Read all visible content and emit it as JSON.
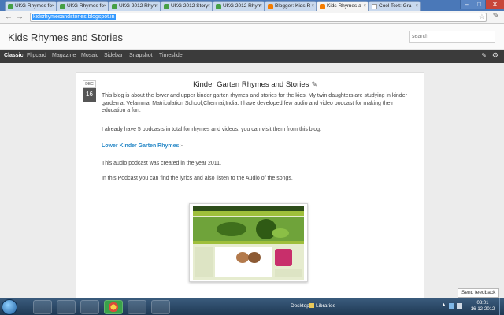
{
  "tabs": [
    {
      "label": "UKG Rhymes fo",
      "favicon": "green-doc-icon"
    },
    {
      "label": "UKG Rhymes fo",
      "favicon": "green-doc-icon"
    },
    {
      "label": "UKG 2012 Rhyn",
      "favicon": "green-doc-icon"
    },
    {
      "label": "UKG 2012 Story",
      "favicon": "green-doc-icon"
    },
    {
      "label": "UKG 2012 Rhym",
      "favicon": "green-doc-icon"
    },
    {
      "label": "Blogger: Kids R",
      "favicon": "blogger-icon"
    },
    {
      "label": "Kids Rhymes a",
      "favicon": "blogger-icon",
      "active": true
    },
    {
      "label": "Cool Text: Gra",
      "favicon": "doc-icon"
    }
  ],
  "address_bar": {
    "url": "kidsrhymesandstories.blogspot.in"
  },
  "blog": {
    "title": "Kids Rhymes and Stories",
    "search_placeholder": "search"
  },
  "views": [
    "Classic",
    "Flipcard",
    "Magazine",
    "Mosaic",
    "Sidebar",
    "Snapshot",
    "Timeslide"
  ],
  "post": {
    "date_month": "DEC",
    "date_day": "16",
    "title": "Kinder Garten Rhymes and Stories",
    "para1": "This blog is about the lower and upper kinder garten rhymes and stories for the kids. My twin daughters are studying in kinder garden at Velammal Matriculation School,Chennai,India. I have developed few audio and video podcast for making their education a fun.",
    "para2": "I already have 5 podcasts in total for rhymes and videos. you can visit them from this blog.",
    "lower_link": "Lower Kinder Garten Rhymes",
    "lower_suffix": ":-",
    "para3": "This audio podcast was created in the year 2011.",
    "para4": "In this Podcast you can find the lyrics and also listen to the Audio of the songs."
  },
  "feedback": "Send feedback",
  "taskbar": {
    "desktop": "Desktop",
    "libraries": "Libraries",
    "time": "08:01",
    "date": "16-12-2012"
  },
  "colors": {
    "link": "#2a8ac8",
    "viewbar": "#3b3b3b",
    "tab_strip": "#4a78b8"
  }
}
